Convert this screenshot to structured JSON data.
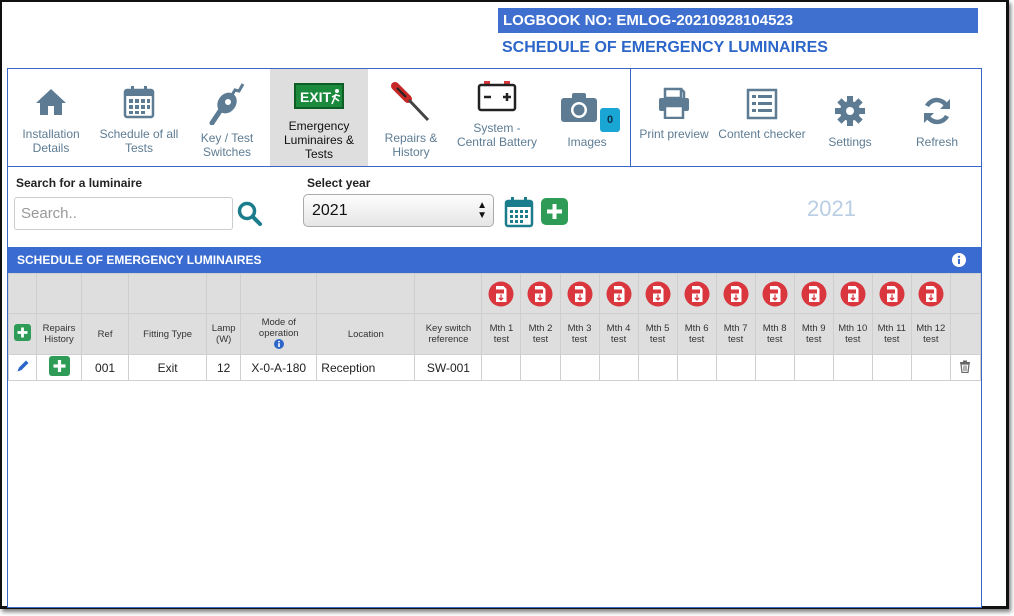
{
  "header": {
    "logbook": "LOGBOOK NO: EMLOG-20210928104523",
    "title": "SCHEDULE OF EMERGENCY LUMINAIRES"
  },
  "toolbar": {
    "items": [
      {
        "label": "Installation Details",
        "icon": "home-icon"
      },
      {
        "label": "Schedule of all Tests",
        "icon": "calendar-icon"
      },
      {
        "label": "Key / Test Switches",
        "icon": "key-switch-icon"
      },
      {
        "label": "Emergency Luminaires & Tests",
        "icon": "exit-sign-icon",
        "active": true
      },
      {
        "label": "Repairs & History",
        "icon": "screwdriver-icon"
      },
      {
        "label": "System - Central Battery",
        "icon": "battery-icon"
      },
      {
        "label": "Images",
        "icon": "camera-icon",
        "badge": "0"
      },
      {
        "label": "Print preview",
        "icon": "print-icon"
      },
      {
        "label": "Content checker",
        "icon": "checklist-icon"
      },
      {
        "label": "Settings",
        "icon": "gear-icon"
      },
      {
        "label": "Refresh",
        "icon": "refresh-icon"
      }
    ],
    "exit_text": "EXIT"
  },
  "search": {
    "label": "Search for a luminaire",
    "placeholder": "Search.."
  },
  "year": {
    "label": "Select year",
    "selected": "2021",
    "display": "2021"
  },
  "section": {
    "title": "SCHEDULE OF EMERGENCY LUMINAIRES"
  },
  "table": {
    "headers": {
      "repairs": "Repairs History",
      "ref": "Ref",
      "fitting": "Fitting Type",
      "lamp": "Lamp (W)",
      "mode": "Mode of operation",
      "location": "Location",
      "keyswitch": "Key switch reference"
    },
    "months": [
      "Mth 1 test",
      "Mth 2 test",
      "Mth 3 test",
      "Mth 4 test",
      "Mth 5 test",
      "Mth 6 test",
      "Mth 7 test",
      "Mth 8 test",
      "Mth 9 test",
      "Mth 10 test",
      "Mth 11 test",
      "Mth 12 test"
    ],
    "rows": [
      {
        "ref": "001",
        "fitting": "Exit",
        "lamp": "12",
        "mode": "X-0-A-180",
        "location": "Reception",
        "keyswitch": "SW-001"
      }
    ]
  },
  "colors": {
    "accent": "#3a6bd0",
    "icon_grey": "#5d7c94",
    "green": "#2e9c57",
    "pdf_red": "#d9363e"
  }
}
